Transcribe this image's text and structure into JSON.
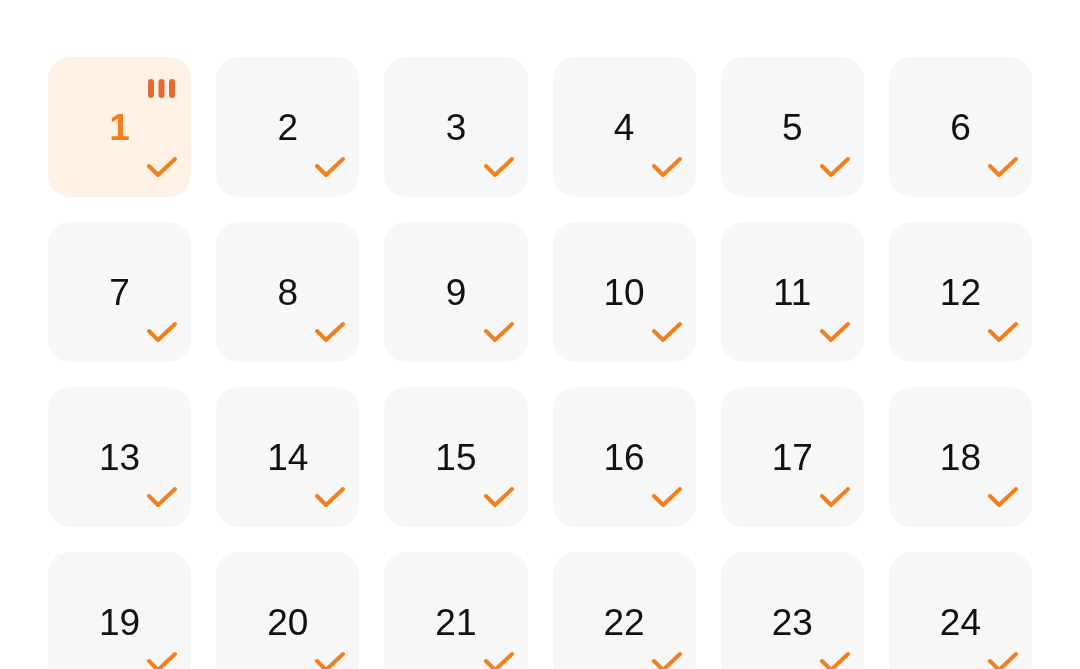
{
  "days": [
    {
      "label": "1",
      "selected": true,
      "checked": true
    },
    {
      "label": "2",
      "selected": false,
      "checked": true
    },
    {
      "label": "3",
      "selected": false,
      "checked": true
    },
    {
      "label": "4",
      "selected": false,
      "checked": true
    },
    {
      "label": "5",
      "selected": false,
      "checked": true
    },
    {
      "label": "6",
      "selected": false,
      "checked": true
    },
    {
      "label": "7",
      "selected": false,
      "checked": true
    },
    {
      "label": "8",
      "selected": false,
      "checked": true
    },
    {
      "label": "9",
      "selected": false,
      "checked": true
    },
    {
      "label": "10",
      "selected": false,
      "checked": true
    },
    {
      "label": "11",
      "selected": false,
      "checked": true
    },
    {
      "label": "12",
      "selected": false,
      "checked": true
    },
    {
      "label": "13",
      "selected": false,
      "checked": true
    },
    {
      "label": "14",
      "selected": false,
      "checked": true
    },
    {
      "label": "15",
      "selected": false,
      "checked": true
    },
    {
      "label": "16",
      "selected": false,
      "checked": true
    },
    {
      "label": "17",
      "selected": false,
      "checked": true
    },
    {
      "label": "18",
      "selected": false,
      "checked": true
    },
    {
      "label": "19",
      "selected": false,
      "checked": true
    },
    {
      "label": "20",
      "selected": false,
      "checked": true
    },
    {
      "label": "21",
      "selected": false,
      "checked": true
    },
    {
      "label": "22",
      "selected": false,
      "checked": true
    },
    {
      "label": "23",
      "selected": false,
      "checked": true
    },
    {
      "label": "24",
      "selected": false,
      "checked": true
    }
  ]
}
